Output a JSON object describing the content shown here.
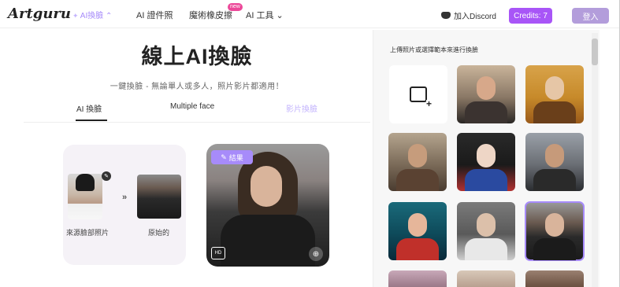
{
  "header": {
    "logo": "Artguru",
    "nav": {
      "ai_faceswap": "AI換臉",
      "ai_photo": "AI 證件照",
      "magic_skin": "魔術橡皮擦",
      "new_badge": "new",
      "ai_tools": "AI 工具"
    },
    "discord": "加入Discord",
    "credits": "Credits: 7",
    "login": "登入"
  },
  "main": {
    "title": "線上AI換臉",
    "subtitle": "一鍵換臉 - 無論單人或多人，照片影片都適用！",
    "tabs": [
      {
        "label": "AI 換臉"
      },
      {
        "label": "Multiple face"
      },
      {
        "label": "影片換臉"
      }
    ],
    "source_label": "來源臉部照片",
    "original_label": "原始的",
    "arrow": "»",
    "result_badge": "結果",
    "hd_label": "HD",
    "zoom_glyph": "⊕"
  },
  "panel": {
    "hint": "上傳照片或選擇範本來進行換臉"
  },
  "colors": {
    "accent": "#a855f7",
    "accent_light": "#a78bfa",
    "login": "#b39ddb",
    "new_badge": "#ec4899"
  }
}
